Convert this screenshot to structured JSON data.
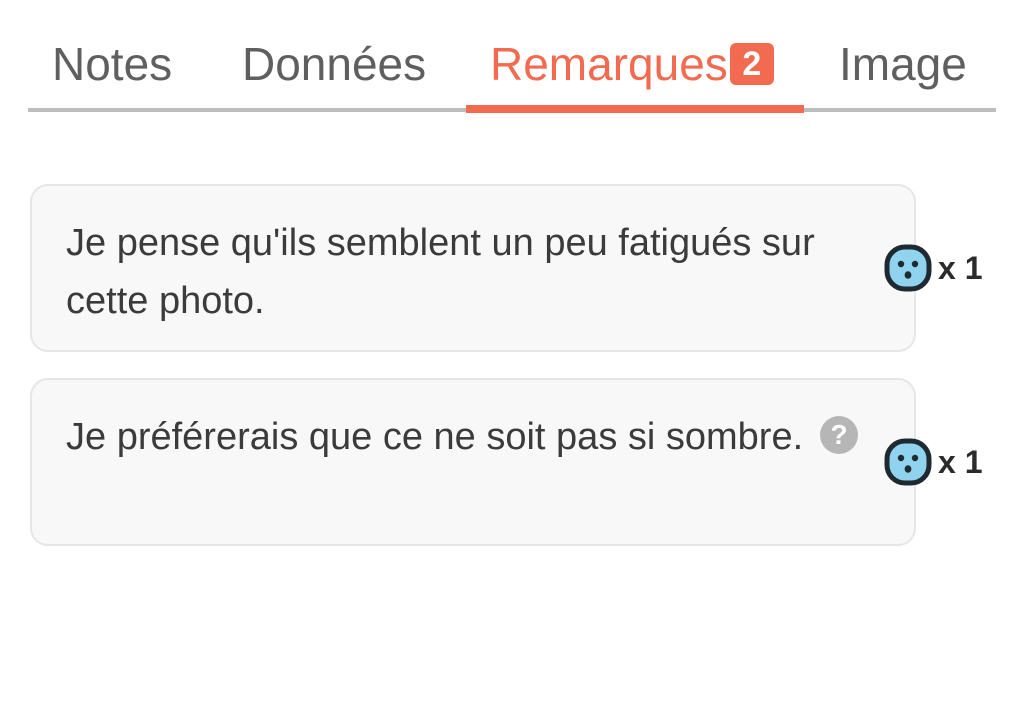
{
  "tabs": {
    "notes": {
      "label": "Notes"
    },
    "donnees": {
      "label": "Données"
    },
    "remarques": {
      "label": "Remarques",
      "badge": "2",
      "active": true
    },
    "image": {
      "label": "Image"
    }
  },
  "remarks": [
    {
      "text": "Je pense qu'ils semblent un peu fatigués sur cette photo.",
      "reaction_icon": "surprised-face-icon",
      "reaction_count": "x 1",
      "has_help_icon": false
    },
    {
      "text": "Je préférerais que ce ne soit pas si sombre.",
      "reaction_icon": "surprised-face-icon",
      "reaction_count": "x 1",
      "has_help_icon": true,
      "help_icon": "question-icon",
      "help_glyph": "?"
    }
  ],
  "colors": {
    "accent": "#f26a4f",
    "tab_inactive": "#5f5f5f",
    "divider": "#bdbdbd",
    "card_background": "#f8f8f8",
    "card_border": "#e6e6e6",
    "face_fill": "#8fd3ef",
    "face_outline": "#1e2a30",
    "help_icon": "#b6b6b6"
  }
}
